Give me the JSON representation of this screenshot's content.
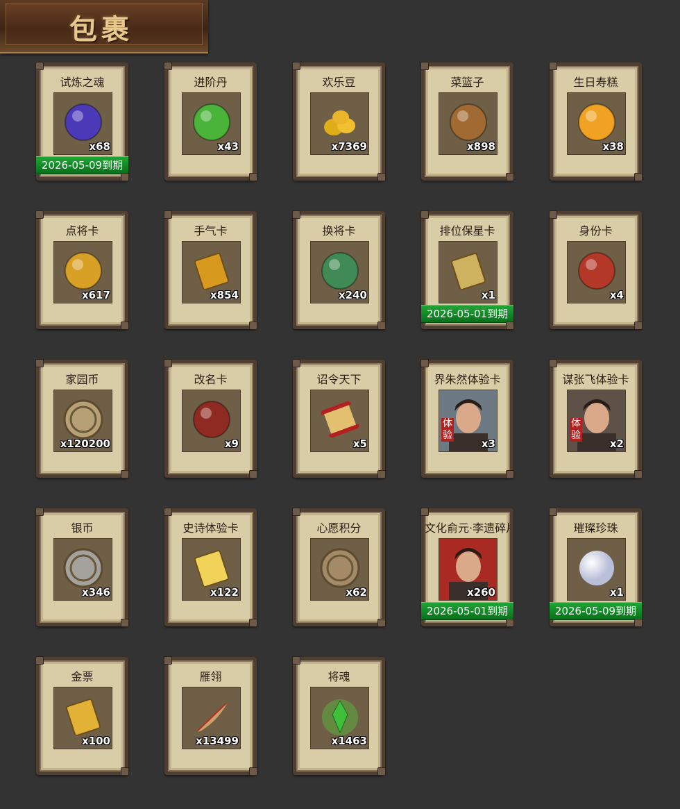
{
  "header": {
    "title": "包裹"
  },
  "items": [
    {
      "name": "试炼之魂",
      "qty": "x68",
      "expiry": "2026-05-09到期",
      "icon": "blue-dragon-orb-icon",
      "color": "#4b3ab8"
    },
    {
      "name": "进阶丹",
      "qty": "x43",
      "expiry": "",
      "icon": "green-pill-icon",
      "color": "#49b33a"
    },
    {
      "name": "欢乐豆",
      "qty": "x7369",
      "expiry": "",
      "icon": "gold-beans-icon",
      "color": "#e0ac18"
    },
    {
      "name": "菜篮子",
      "qty": "x898",
      "expiry": "",
      "icon": "flower-basket-icon",
      "color": "#a06a32"
    },
    {
      "name": "生日寿糕",
      "qty": "x38",
      "expiry": "",
      "icon": "birthday-cake-icon",
      "color": "#f0a224"
    },
    {
      "name": "点将卡",
      "qty": "x617",
      "expiry": "",
      "icon": "select-general-card-icon",
      "color": "#d9a026"
    },
    {
      "name": "手气卡",
      "qty": "x854",
      "expiry": "",
      "icon": "luck-card-icon",
      "color": "#d89a1e"
    },
    {
      "name": "换将卡",
      "qty": "x240",
      "expiry": "",
      "icon": "swap-general-card-icon",
      "color": "#3f8a55"
    },
    {
      "name": "排位保星卡",
      "qty": "x1",
      "expiry": "2026-05-01到期",
      "icon": "rank-star-card-icon",
      "color": "#cfb260"
    },
    {
      "name": "身份卡",
      "qty": "x4",
      "expiry": "",
      "icon": "identity-mask-card-icon",
      "color": "#b33828"
    },
    {
      "name": "家园币",
      "qty": "x120200",
      "expiry": "",
      "icon": "home-coin-icon",
      "color": "#b6a074"
    },
    {
      "name": "改名卡",
      "qty": "x9",
      "expiry": "",
      "icon": "rename-card-icon",
      "color": "#8f2a22"
    },
    {
      "name": "诏令天下",
      "qty": "x5",
      "expiry": "",
      "icon": "edict-scroll-icon",
      "color": "#e3c070"
    },
    {
      "name": "界朱然体验卡",
      "qty": "x3",
      "expiry": "",
      "icon": "zhuran-portrait-icon",
      "color": "#6d7a84",
      "trial": "体验"
    },
    {
      "name": "谋张飞体验卡",
      "qty": "x2",
      "expiry": "",
      "icon": "zhangfei-portrait-icon",
      "color": "#5e5248",
      "trial": "体验"
    },
    {
      "name": "银币",
      "qty": "x346",
      "expiry": "",
      "icon": "silver-coins-icon",
      "color": "#a4a29c"
    },
    {
      "name": "史诗体验卡",
      "qty": "x122",
      "expiry": "",
      "icon": "epic-trial-card-icon",
      "color": "#f2d35a"
    },
    {
      "name": "心愿积分",
      "qty": "x62",
      "expiry": "",
      "icon": "heart-coin-icon",
      "color": "#a48a66"
    },
    {
      "name": "文化俞元·李遗碎片",
      "qty": "x260",
      "expiry": "2026-05-01到期",
      "icon": "hero-shard-portrait-icon",
      "color": "#a82a22"
    },
    {
      "name": "璀璨珍珠",
      "qty": "x1",
      "expiry": "2026-05-09到期",
      "icon": "pearl-icon",
      "color": "#e8eaf4"
    },
    {
      "name": "金票",
      "qty": "x100",
      "expiry": "",
      "icon": "gold-ticket-icon",
      "color": "#e2b236"
    },
    {
      "name": "雁翎",
      "qty": "x13499",
      "expiry": "",
      "icon": "feather-icon",
      "color": "#c8a070"
    },
    {
      "name": "将魂",
      "qty": "x1463",
      "expiry": "",
      "icon": "green-crystal-icon",
      "color": "#3fc03a"
    }
  ]
}
